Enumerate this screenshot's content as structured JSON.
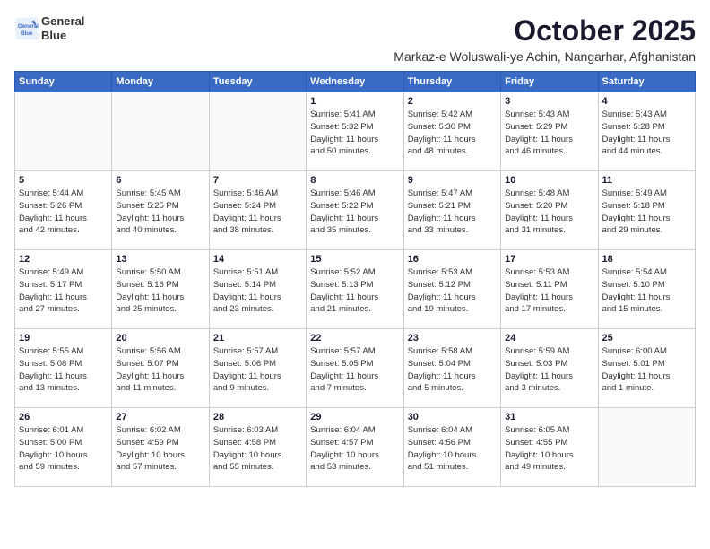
{
  "logo": {
    "line1": "General",
    "line2": "Blue"
  },
  "title": "October 2025",
  "subtitle": "Markaz-e Woluswali-ye Achin, Nangarhar, Afghanistan",
  "days_of_week": [
    "Sunday",
    "Monday",
    "Tuesday",
    "Wednesday",
    "Thursday",
    "Friday",
    "Saturday"
  ],
  "weeks": [
    [
      {
        "day": "",
        "info": ""
      },
      {
        "day": "",
        "info": ""
      },
      {
        "day": "",
        "info": ""
      },
      {
        "day": "1",
        "info": "Sunrise: 5:41 AM\nSunset: 5:32 PM\nDaylight: 11 hours\nand 50 minutes."
      },
      {
        "day": "2",
        "info": "Sunrise: 5:42 AM\nSunset: 5:30 PM\nDaylight: 11 hours\nand 48 minutes."
      },
      {
        "day": "3",
        "info": "Sunrise: 5:43 AM\nSunset: 5:29 PM\nDaylight: 11 hours\nand 46 minutes."
      },
      {
        "day": "4",
        "info": "Sunrise: 5:43 AM\nSunset: 5:28 PM\nDaylight: 11 hours\nand 44 minutes."
      }
    ],
    [
      {
        "day": "5",
        "info": "Sunrise: 5:44 AM\nSunset: 5:26 PM\nDaylight: 11 hours\nand 42 minutes."
      },
      {
        "day": "6",
        "info": "Sunrise: 5:45 AM\nSunset: 5:25 PM\nDaylight: 11 hours\nand 40 minutes."
      },
      {
        "day": "7",
        "info": "Sunrise: 5:46 AM\nSunset: 5:24 PM\nDaylight: 11 hours\nand 38 minutes."
      },
      {
        "day": "8",
        "info": "Sunrise: 5:46 AM\nSunset: 5:22 PM\nDaylight: 11 hours\nand 35 minutes."
      },
      {
        "day": "9",
        "info": "Sunrise: 5:47 AM\nSunset: 5:21 PM\nDaylight: 11 hours\nand 33 minutes."
      },
      {
        "day": "10",
        "info": "Sunrise: 5:48 AM\nSunset: 5:20 PM\nDaylight: 11 hours\nand 31 minutes."
      },
      {
        "day": "11",
        "info": "Sunrise: 5:49 AM\nSunset: 5:18 PM\nDaylight: 11 hours\nand 29 minutes."
      }
    ],
    [
      {
        "day": "12",
        "info": "Sunrise: 5:49 AM\nSunset: 5:17 PM\nDaylight: 11 hours\nand 27 minutes."
      },
      {
        "day": "13",
        "info": "Sunrise: 5:50 AM\nSunset: 5:16 PM\nDaylight: 11 hours\nand 25 minutes."
      },
      {
        "day": "14",
        "info": "Sunrise: 5:51 AM\nSunset: 5:14 PM\nDaylight: 11 hours\nand 23 minutes."
      },
      {
        "day": "15",
        "info": "Sunrise: 5:52 AM\nSunset: 5:13 PM\nDaylight: 11 hours\nand 21 minutes."
      },
      {
        "day": "16",
        "info": "Sunrise: 5:53 AM\nSunset: 5:12 PM\nDaylight: 11 hours\nand 19 minutes."
      },
      {
        "day": "17",
        "info": "Sunrise: 5:53 AM\nSunset: 5:11 PM\nDaylight: 11 hours\nand 17 minutes."
      },
      {
        "day": "18",
        "info": "Sunrise: 5:54 AM\nSunset: 5:10 PM\nDaylight: 11 hours\nand 15 minutes."
      }
    ],
    [
      {
        "day": "19",
        "info": "Sunrise: 5:55 AM\nSunset: 5:08 PM\nDaylight: 11 hours\nand 13 minutes."
      },
      {
        "day": "20",
        "info": "Sunrise: 5:56 AM\nSunset: 5:07 PM\nDaylight: 11 hours\nand 11 minutes."
      },
      {
        "day": "21",
        "info": "Sunrise: 5:57 AM\nSunset: 5:06 PM\nDaylight: 11 hours\nand 9 minutes."
      },
      {
        "day": "22",
        "info": "Sunrise: 5:57 AM\nSunset: 5:05 PM\nDaylight: 11 hours\nand 7 minutes."
      },
      {
        "day": "23",
        "info": "Sunrise: 5:58 AM\nSunset: 5:04 PM\nDaylight: 11 hours\nand 5 minutes."
      },
      {
        "day": "24",
        "info": "Sunrise: 5:59 AM\nSunset: 5:03 PM\nDaylight: 11 hours\nand 3 minutes."
      },
      {
        "day": "25",
        "info": "Sunrise: 6:00 AM\nSunset: 5:01 PM\nDaylight: 11 hours\nand 1 minute."
      }
    ],
    [
      {
        "day": "26",
        "info": "Sunrise: 6:01 AM\nSunset: 5:00 PM\nDaylight: 10 hours\nand 59 minutes."
      },
      {
        "day": "27",
        "info": "Sunrise: 6:02 AM\nSunset: 4:59 PM\nDaylight: 10 hours\nand 57 minutes."
      },
      {
        "day": "28",
        "info": "Sunrise: 6:03 AM\nSunset: 4:58 PM\nDaylight: 10 hours\nand 55 minutes."
      },
      {
        "day": "29",
        "info": "Sunrise: 6:04 AM\nSunset: 4:57 PM\nDaylight: 10 hours\nand 53 minutes."
      },
      {
        "day": "30",
        "info": "Sunrise: 6:04 AM\nSunset: 4:56 PM\nDaylight: 10 hours\nand 51 minutes."
      },
      {
        "day": "31",
        "info": "Sunrise: 6:05 AM\nSunset: 4:55 PM\nDaylight: 10 hours\nand 49 minutes."
      },
      {
        "day": "",
        "info": ""
      }
    ]
  ]
}
